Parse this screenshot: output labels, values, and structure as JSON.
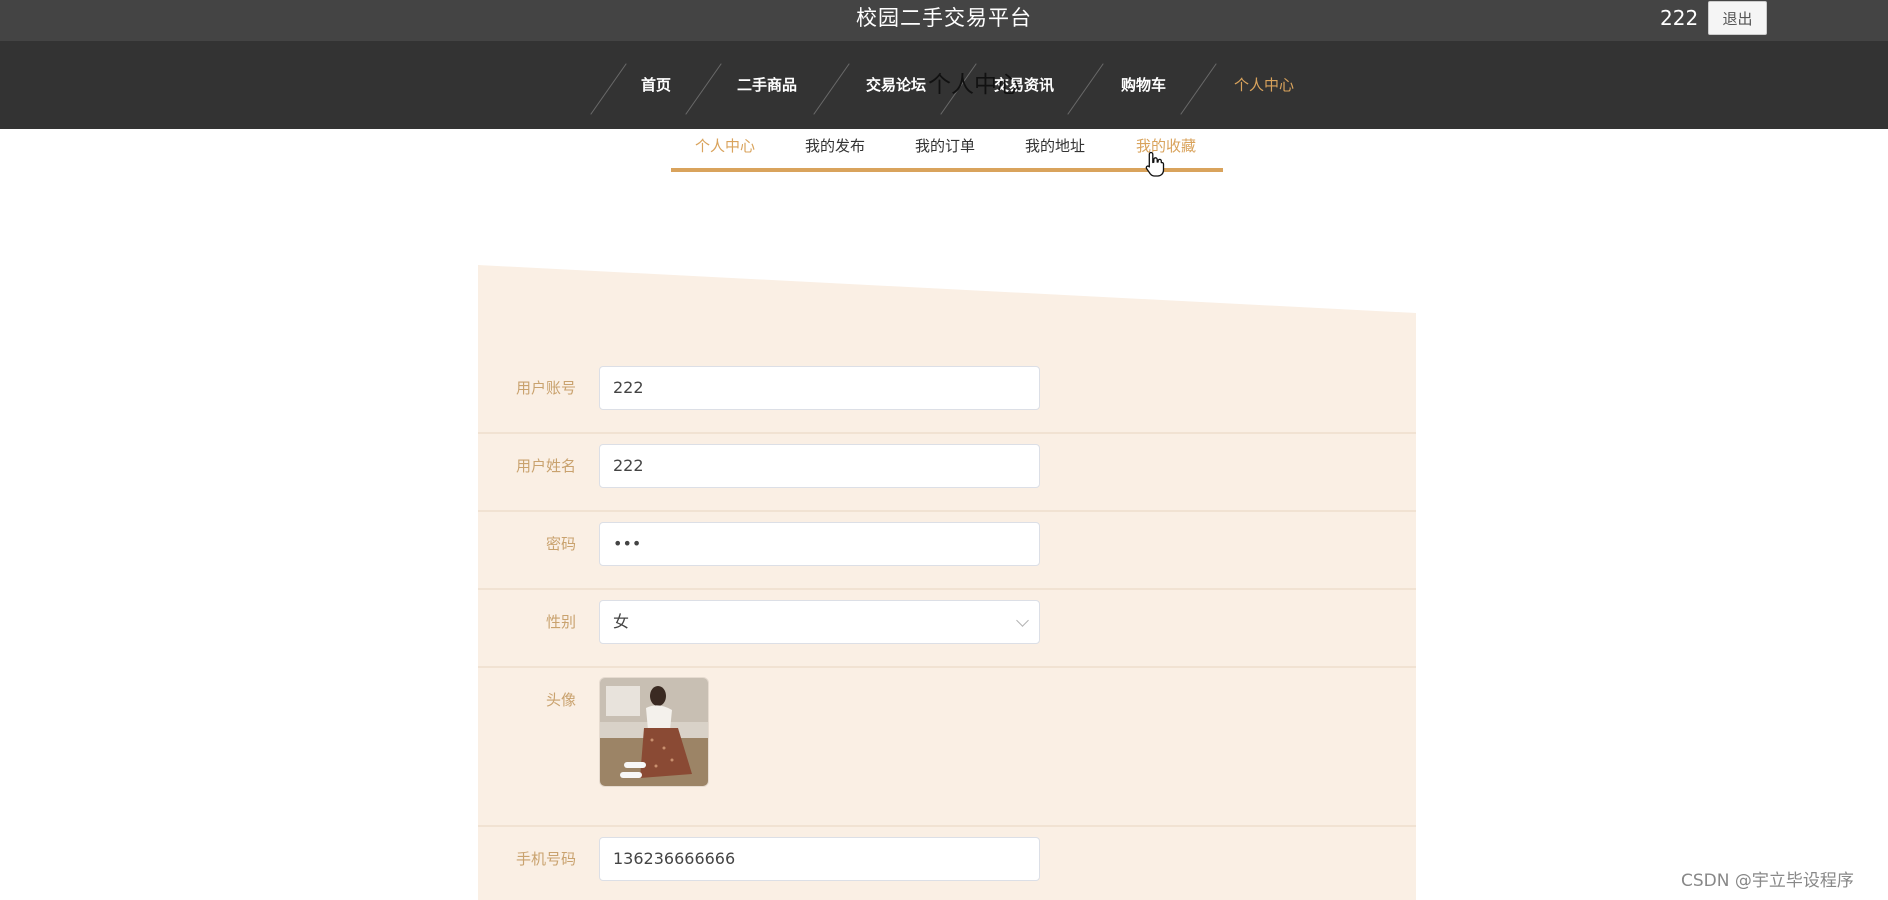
{
  "header": {
    "site_title": "校园二手交易平台",
    "username": "222",
    "logout_label": "退出"
  },
  "nav": {
    "items": [
      {
        "label": "首页"
      },
      {
        "label": "二手商品"
      },
      {
        "label": "交易论坛"
      },
      {
        "label": "交易资讯"
      },
      {
        "label": "购物车"
      },
      {
        "label": "个人中心",
        "active": true
      }
    ],
    "page_title_overlap": "个人中心"
  },
  "subnav": {
    "items": [
      {
        "label": "个人中心",
        "active": true
      },
      {
        "label": "我的发布"
      },
      {
        "label": "我的订单"
      },
      {
        "label": "我的地址"
      },
      {
        "label": "我的收藏",
        "hovered": true
      }
    ]
  },
  "form": {
    "account": {
      "label": "用户账号",
      "value": "222"
    },
    "name": {
      "label": "用户姓名",
      "value": "222"
    },
    "password": {
      "label": "密码",
      "value": "•••"
    },
    "gender": {
      "label": "性别",
      "value": "女"
    },
    "avatar": {
      "label": "头像"
    },
    "phone": {
      "label": "手机号码",
      "value": "136236666666"
    }
  },
  "watermark": "CSDN @宇立毕设程序",
  "colors": {
    "accent": "#d9a35c",
    "topbar": "#444444",
    "nav": "#333333",
    "panel": "#faefe4"
  },
  "icons": {
    "cursor": "hand-pointer-icon",
    "select": "chevron-down-icon"
  }
}
